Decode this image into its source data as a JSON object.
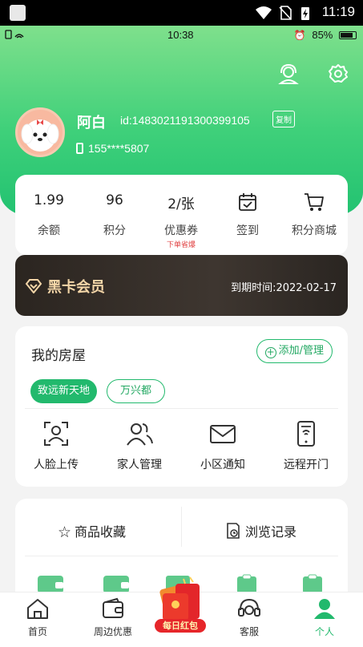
{
  "system_status": {
    "time": "11:19"
  },
  "phone_status": {
    "time": "10:38",
    "battery": "85%"
  },
  "header_icons": {
    "service": "headset-icon",
    "settings": "gear-icon"
  },
  "profile": {
    "name": "阿白",
    "id": "id:1483021191300399105",
    "copy_label": "复制",
    "phone": "155****5807"
  },
  "stats": [
    {
      "value": "1.99",
      "label": "余额",
      "sub": ""
    },
    {
      "value": "96",
      "label": "积分",
      "sub": ""
    },
    {
      "value": "2/张",
      "label": "优惠券",
      "sub": "下单省爆"
    },
    {
      "value": "",
      "label": "签到",
      "sub": ""
    },
    {
      "value": "",
      "label": "积分商城",
      "sub": ""
    }
  ],
  "vip": {
    "title": "黑卡会员",
    "expire": "到期时间:2022-02-17"
  },
  "house": {
    "title": "我的房屋",
    "add_label": "添加/管理",
    "chips": [
      "致远新天地",
      "万兴都"
    ],
    "actions": [
      {
        "label": "人脸上传",
        "icon": "face-scan-icon"
      },
      {
        "label": "家人管理",
        "icon": "family-icon"
      },
      {
        "label": "小区通知",
        "icon": "mail-icon"
      },
      {
        "label": "远程开门",
        "icon": "phone-door-icon"
      }
    ]
  },
  "favorites": {
    "goods": "商品收藏",
    "history": "浏览记录"
  },
  "tabbar": {
    "items": [
      "首页",
      "周边优惠",
      "每日红包",
      "客服",
      "个人"
    ],
    "active": "个人"
  },
  "colors": {
    "accent": "#22b96d",
    "vip_gold": "#f4d6a8",
    "hero_top": "#7fe08c"
  }
}
